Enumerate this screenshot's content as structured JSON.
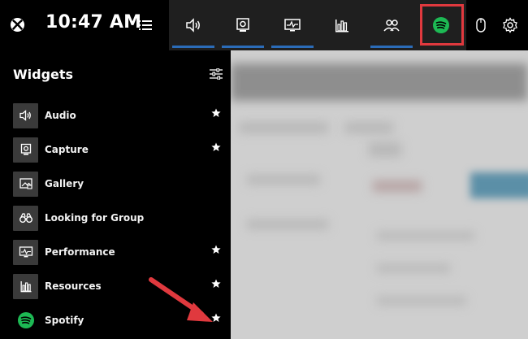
{
  "clock": {
    "time": "10:47 AM"
  },
  "widget_bar": {
    "tabs": [
      {
        "name": "audio",
        "icon": "speaker-icon",
        "pinned": true
      },
      {
        "name": "capture",
        "icon": "capture-icon",
        "pinned": true
      },
      {
        "name": "performance",
        "icon": "performance-icon",
        "pinned": true
      },
      {
        "name": "resources",
        "icon": "resources-icon",
        "pinned": false
      },
      {
        "name": "looking-for-group",
        "icon": "group-icon",
        "pinned": true
      },
      {
        "name": "spotify",
        "icon": "spotify-icon",
        "pinned": false,
        "highlighted": true
      }
    ]
  },
  "panel": {
    "title": "Widgets",
    "items": [
      {
        "label": "Audio",
        "icon": "speaker-icon",
        "favorite": true
      },
      {
        "label": "Capture",
        "icon": "capture-icon",
        "favorite": true
      },
      {
        "label": "Gallery",
        "icon": "gallery-icon",
        "favorite": false
      },
      {
        "label": "Looking for Group",
        "icon": "binoculars-icon",
        "favorite": false
      },
      {
        "label": "Performance",
        "icon": "performance-icon",
        "favorite": true
      },
      {
        "label": "Resources",
        "icon": "resources-icon",
        "favorite": true
      },
      {
        "label": "Spotify",
        "icon": "spotify-icon",
        "favorite": true
      }
    ]
  },
  "colors": {
    "highlight": "#e0393e",
    "spotify_green": "#1db954",
    "accent_blue": "#2b6cb8"
  }
}
